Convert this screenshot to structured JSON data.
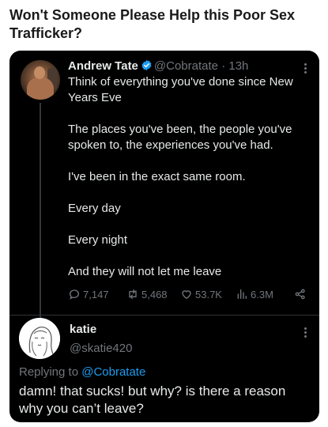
{
  "post": {
    "title": "Won't Someone Please Help this Poor Sex Trafficker?"
  },
  "tweet": {
    "name": "Andrew Tate",
    "handle": "@Cobratate",
    "separator": "·",
    "time": "13h",
    "paragraphs": [
      "Think of everything you've done since New Years Eve",
      "The places you've been, the people you've spoken to, the experiences you've had.",
      "I've been in the exact same room.",
      "Every day",
      "Every night",
      "And they will not let me leave"
    ],
    "stats": {
      "replies": "7,147",
      "retweets": "5,468",
      "likes": "53.7K",
      "views": "6.3M"
    }
  },
  "reply": {
    "name": "katie",
    "handle": "@skatie420",
    "replying_prefix": "Replying to",
    "replying_to": "@Cobratate",
    "text": "damn! that sucks! but why? is there a reason why you can’t leave?"
  },
  "colors": {
    "card_background": "#000000",
    "text_primary": "#e7e9ea",
    "text_secondary": "#71767b",
    "accent": "#1d9bf0",
    "verified_badge": "#1d9bf0"
  },
  "icons": {
    "verified": "verified-badge-icon",
    "reply": "comment-bubble-icon",
    "retweet": "retweet-icon",
    "like": "heart-icon",
    "views": "bar-chart-icon",
    "share": "share-icon",
    "more": "more-vertical-icon"
  }
}
